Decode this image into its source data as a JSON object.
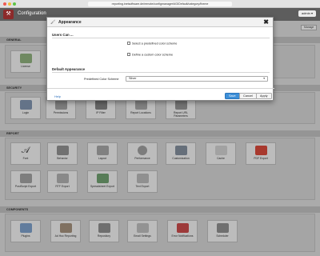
{
  "browser": {
    "url": "reporting.inetsoftware.de/remote/configmanager/#/3/Default/category/theme"
  },
  "app": {
    "title": "Configuration",
    "user": "admin ▾",
    "manage": "Manage"
  },
  "sections": {
    "general": "GENERAL",
    "security": "SECURITY",
    "report": "REPORT",
    "components": "COMPONENTS"
  },
  "general_tiles": [
    "License"
  ],
  "security_tiles": [
    "Login",
    "Permissions",
    "IP Filter",
    "Report Locations",
    "Report URL Parameters"
  ],
  "report_tiles_row1": [
    "Font",
    "Behavior",
    "Layout",
    "Performance",
    "Customization",
    "Cache",
    "PDF Export"
  ],
  "report_tiles_row2": [
    "PostScript Export",
    "RTF Export",
    "Spreadsheet Export",
    "Text Export"
  ],
  "component_tiles": [
    "Plugins",
    "Ad Hoc Reporting",
    "Repository",
    "Email Settings",
    "Error Notifications",
    "Scheduler"
  ],
  "dialog": {
    "title": "Appearance",
    "close": "✖",
    "users_heading": "Users Can ...",
    "opt1": "Select a predefined color scheme",
    "opt2": "Define a custom color scheme",
    "default_heading": "Default Appearance",
    "field_label": "Predefined Color Scheme",
    "select_value": "Silver",
    "help": "Help",
    "save": "Save",
    "cancel": "Cancel",
    "apply": "Apply"
  },
  "colors": {
    "accent": "#3d8fd8",
    "brand": "#8c2a2a"
  }
}
